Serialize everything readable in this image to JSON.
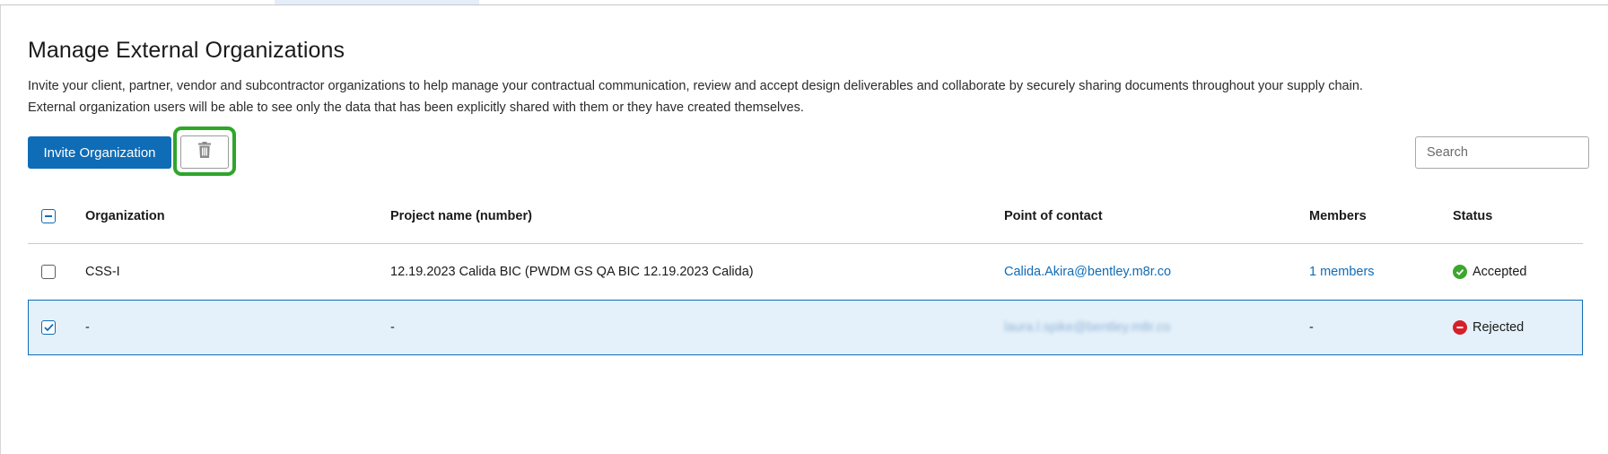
{
  "page": {
    "title": "Manage External Organizations",
    "description_line1": "Invite your client, partner, vendor and subcontractor organizations to help manage your contractual communication, review and accept design deliverables and collaborate by securely sharing documents throughout your supply chain.",
    "description_line2": "External organization users will be able to see only the data that has been explicitly shared with them or they have created themselves."
  },
  "toolbar": {
    "invite_label": "Invite Organization",
    "delete_icon": "trash-icon",
    "search_placeholder": "Search",
    "search_value": ""
  },
  "table": {
    "columns": [
      "Organization",
      "Project name (number)",
      "Point of contact",
      "Members",
      "Status"
    ],
    "select_all_state": "indeterminate",
    "rows": [
      {
        "selected": false,
        "organization": "CSS-I",
        "project": "12.19.2023 Calida BIC (PWDM GS QA BIC 12.19.2023 Calida)",
        "contact": "Calida.Akira@bentley.m8r.co",
        "members": "1 members",
        "status": "Accepted",
        "status_icon": "check-circle-icon"
      },
      {
        "selected": true,
        "organization": "-",
        "project": "-",
        "contact": "laura.l.spike@bentley.m8r.co",
        "members": "-",
        "status": "Rejected",
        "status_icon": "minus-circle-icon"
      }
    ]
  },
  "colors": {
    "primary": "#0f6cb6",
    "highlight": "#2ea62a",
    "accepted": "#3da62f",
    "rejected": "#d6202a",
    "selected_row": "#e5f1fa"
  }
}
